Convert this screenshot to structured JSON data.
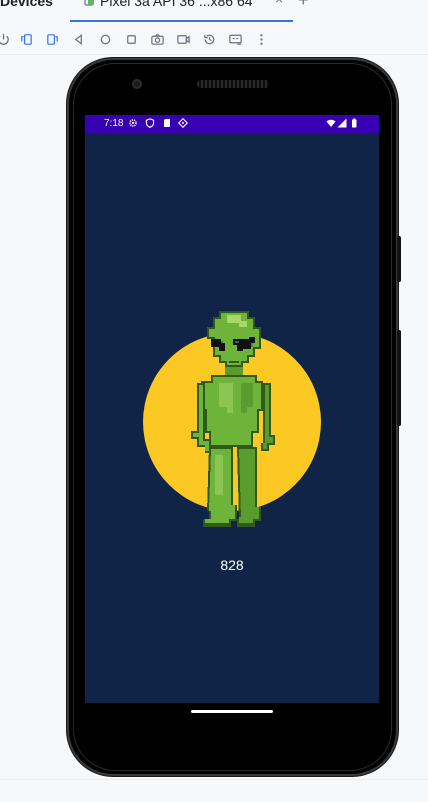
{
  "tool_window": {
    "title": "Devices"
  },
  "tab": {
    "label": "Pixel 3a API 36 ...x86 64",
    "close_glyph": "×",
    "add_glyph": "+"
  },
  "toolbar": {
    "buttons": [
      "rotate-left-icon",
      "rotate-right-icon",
      "back-icon",
      "home-icon",
      "overview-icon",
      "screenshot-icon",
      "screen-record-icon",
      "snapshot-icon",
      "extended-controls-icon",
      "more-icon"
    ]
  },
  "status_bar": {
    "time": "7:18",
    "color": "#3700b3"
  },
  "app": {
    "background_color": "#0f2446",
    "sun_color": "#fcc824",
    "counter": "828"
  }
}
